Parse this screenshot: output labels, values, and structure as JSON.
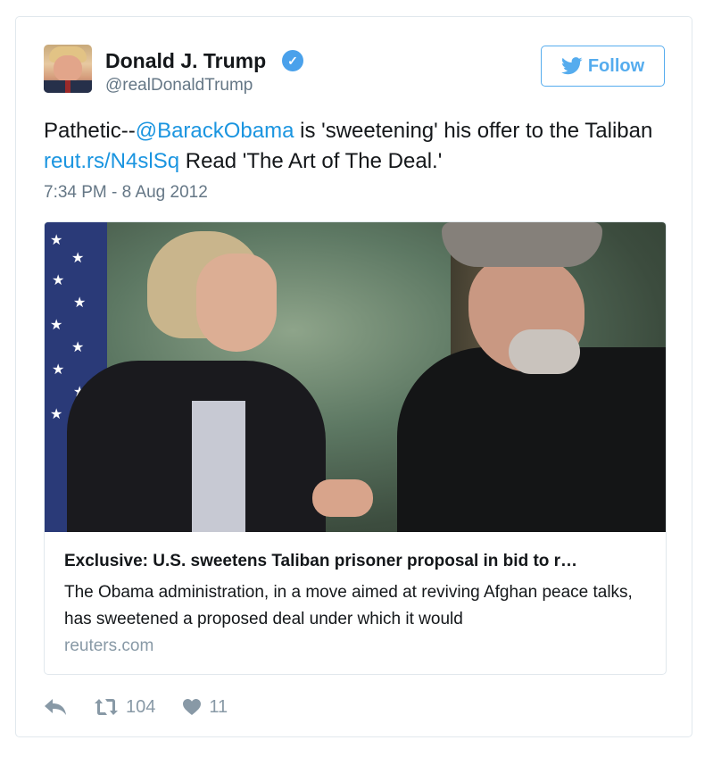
{
  "author": {
    "name": "Donald J. Trump",
    "handle": "@realDonaldTrump",
    "verified": true,
    "avatar_icon": "profile-photo"
  },
  "follow_button": {
    "label": "Follow",
    "icon": "twitter-bird-icon"
  },
  "tweet": {
    "text_before_mention": "Pathetic--",
    "mention": "@BarackObama",
    "text_after_mention": " is 'sweetening' his offer to the Taliban",
    "link": "reut.rs/N4slSq",
    "text_after_link": " Read 'The Art of The Deal.'",
    "timestamp": "7:34 PM - 8 Aug 2012"
  },
  "link_card": {
    "title": "Exclusive: U.S. sweetens Taliban prisoner proposal in bid to r…",
    "description": "The Obama administration, in a move aimed at reviving Afghan peace talks, has sweetened a proposed deal under which it would",
    "domain": "reuters.com"
  },
  "actions": {
    "reply_icon": "reply-icon",
    "retweet_icon": "retweet-icon",
    "retweet_count": "104",
    "like_icon": "heart-icon",
    "like_count": "11"
  },
  "colors": {
    "link_blue": "#1b95e0",
    "follow_blue": "#55acee",
    "muted_gray": "#657786",
    "border": "#e1e8ed"
  }
}
